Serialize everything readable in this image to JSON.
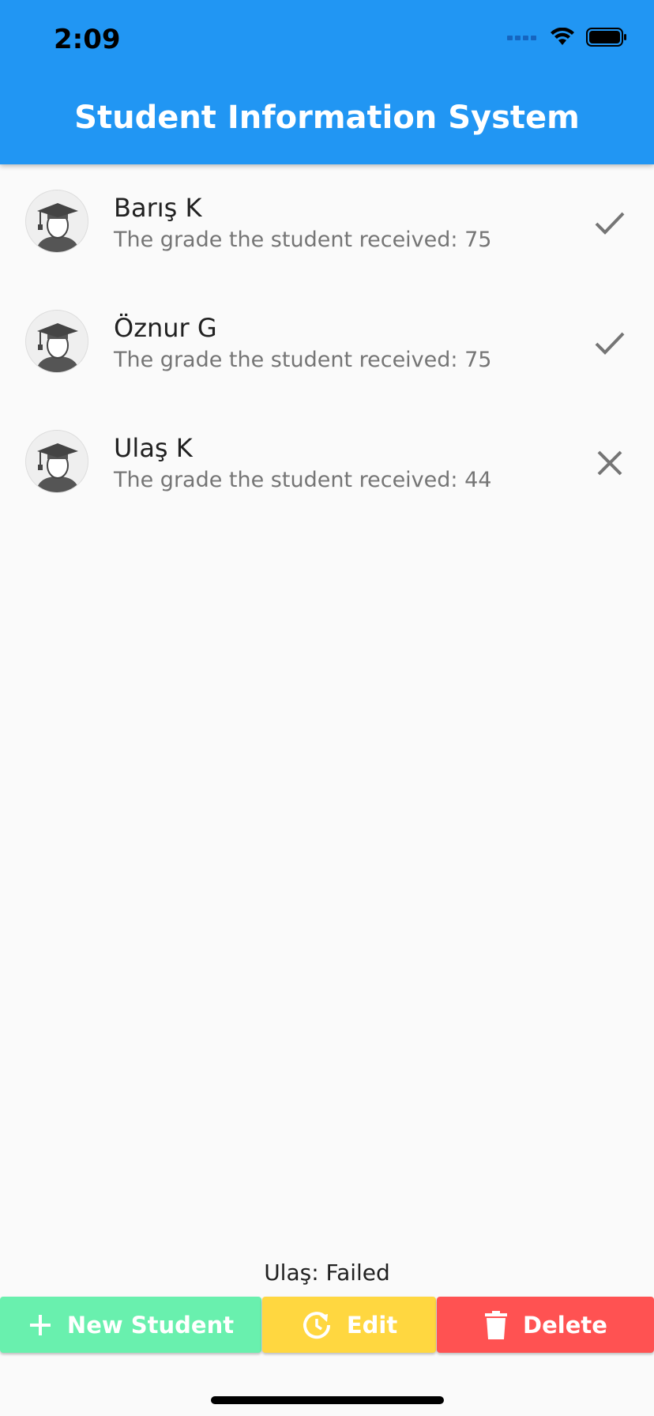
{
  "status_bar": {
    "time": "2:09",
    "signal_icon": "cellular-signal-icon",
    "wifi_icon": "wifi-icon",
    "battery_icon": "battery-icon"
  },
  "app_bar": {
    "title": "Student Information System",
    "background": "#2196f3"
  },
  "students": [
    {
      "name": "Barış K",
      "grade_text": "The grade the student received: 75",
      "grade": 75,
      "status_icon": "check-icon",
      "avatar_icon": "graduate-avatar-icon"
    },
    {
      "name": "Öznur G",
      "grade_text": "The grade the student received: 75",
      "grade": 75,
      "status_icon": "check-icon",
      "avatar_icon": "graduate-avatar-icon"
    },
    {
      "name": "Ulaş K",
      "grade_text": "The grade the student received: 44",
      "grade": 44,
      "status_icon": "close-icon",
      "avatar_icon": "graduate-avatar-icon"
    }
  ],
  "selected_status": "Ulaş: Failed",
  "buttons": {
    "new": {
      "label": "New Student",
      "icon": "plus-icon",
      "color": "#69f0ae"
    },
    "edit": {
      "label": "Edit",
      "icon": "refresh-icon",
      "color": "#ffd740"
    },
    "delete": {
      "label": "Delete",
      "icon": "trash-icon",
      "color": "#ff5252"
    }
  }
}
